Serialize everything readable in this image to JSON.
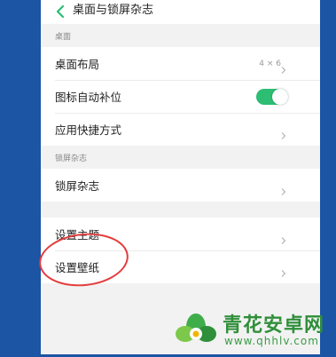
{
  "header": {
    "title": "桌面与锁屏杂志"
  },
  "sections": [
    {
      "label": "桌面"
    },
    {
      "label": "锁屏杂志"
    }
  ],
  "desktop": {
    "layout": {
      "label": "桌面布局",
      "value": "4 × 6"
    },
    "auto_fill": {
      "label": "图标自动补位",
      "enabled": true
    },
    "shortcuts": {
      "label": "应用快捷方式"
    }
  },
  "lockscreen": {
    "magazine": {
      "label": "锁屏杂志"
    }
  },
  "other": {
    "theme": {
      "label": "设置主题"
    },
    "wallpaper": {
      "label": "设置壁纸"
    }
  },
  "watermark": {
    "name": "青花安卓网",
    "url": "www.qhhlv.com"
  },
  "colors": {
    "toggle_on": "#2dbd73",
    "back_arrow": "#2dbd73",
    "annotation": "#e43c3c",
    "outer_background": "#1b55a4"
  }
}
